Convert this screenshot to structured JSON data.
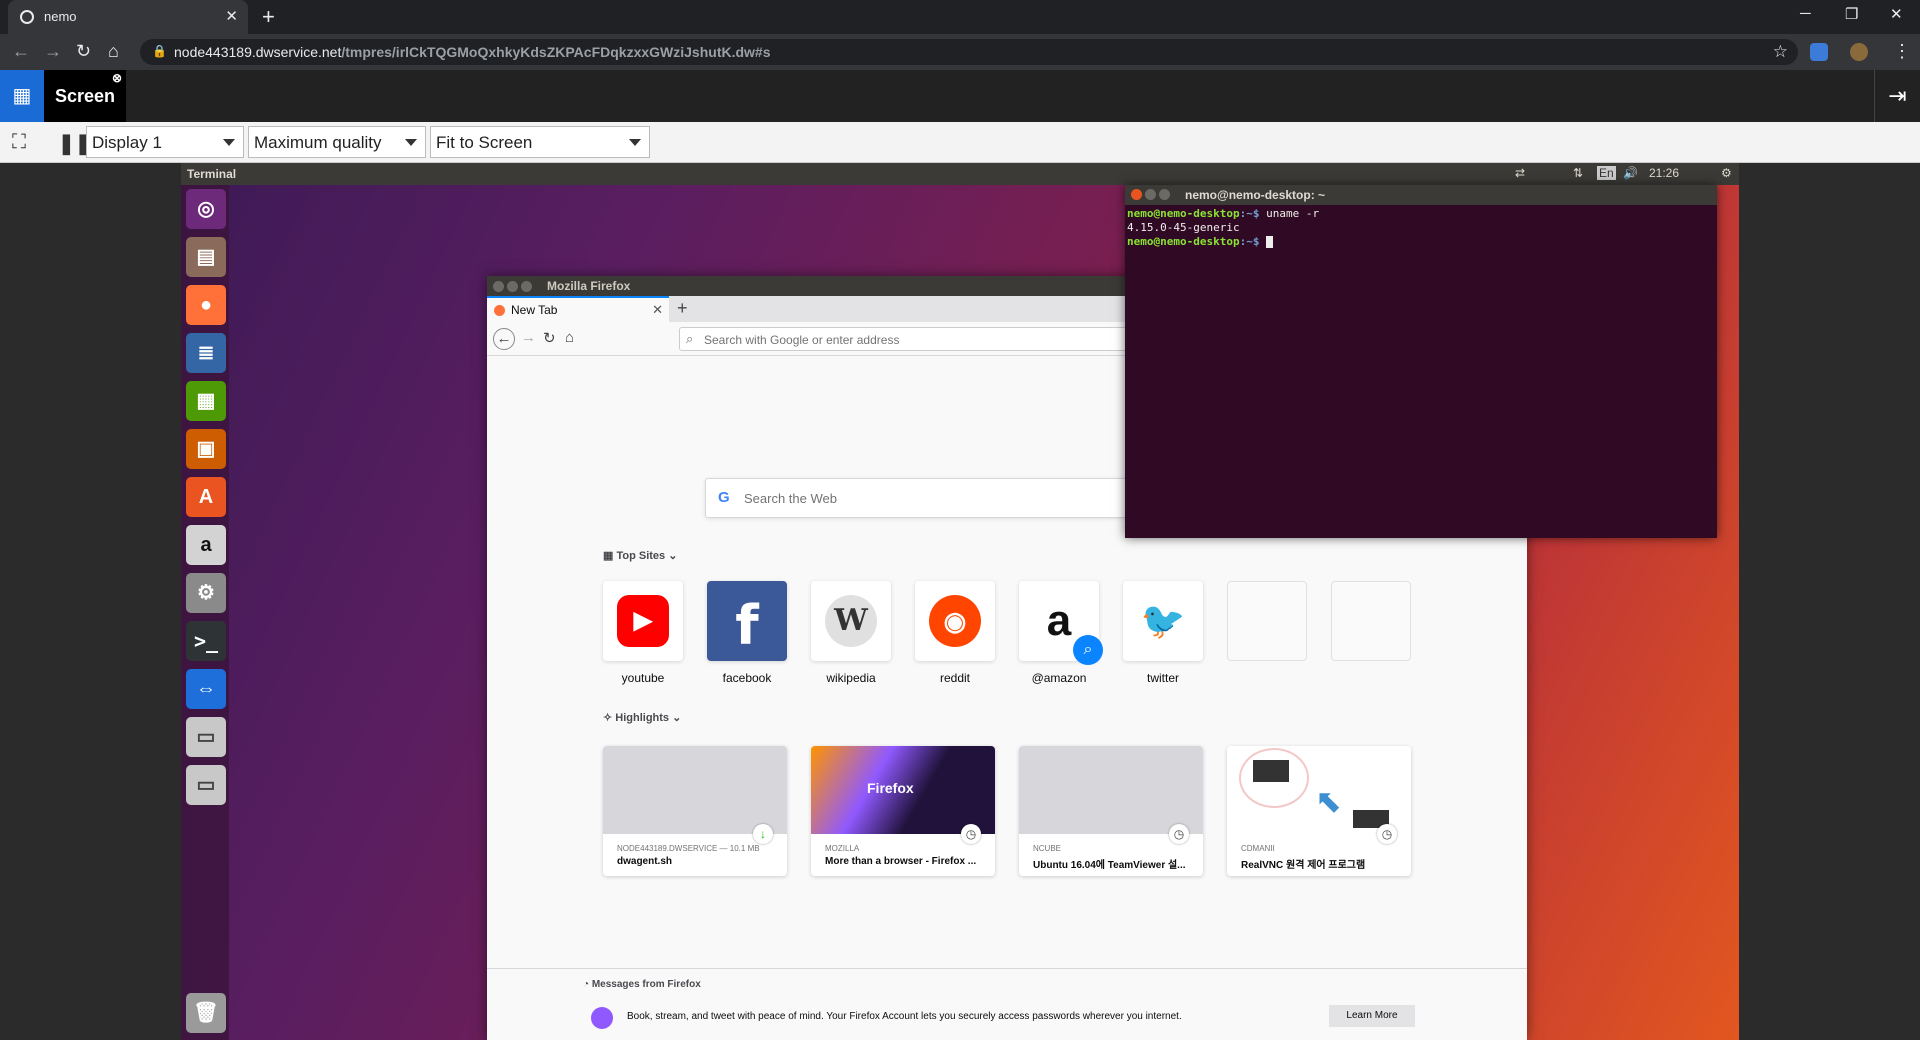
{
  "browser": {
    "tab_title": "nemo",
    "url_host": "node443189.dwservice.net",
    "url_path": "/tmpres/irlCkTQGMoQxhkyKdsZKPAcFDqkzxxGWziJshutK.dw#s"
  },
  "dwservice": {
    "screen_label": "Screen",
    "display_select": "Display 1",
    "quality_select": "Maximum quality",
    "fit_select": "Fit to Screen"
  },
  "remote": {
    "top_panel_title": "Terminal",
    "time": "21:26",
    "keyboard_lang": "En"
  },
  "firefox": {
    "window_title": "Mozilla Firefox",
    "tab_title": "New Tab",
    "address_placeholder": "Search with Google or enter address",
    "web_search_placeholder": "Search the Web",
    "top_sites_label": "Top Sites",
    "top_sites": [
      {
        "label": "youtube"
      },
      {
        "label": "facebook"
      },
      {
        "label": "wikipedia"
      },
      {
        "label": "reddit"
      },
      {
        "label": "@amazon"
      },
      {
        "label": "twitter"
      }
    ],
    "highlights_label": "Highlights",
    "highlights": [
      {
        "source": "NODE443189.DWSERVICE — 10.1 MB",
        "title": "dwagent.sh"
      },
      {
        "source": "MOZILLA",
        "title": "More than a browser - Firefox ..."
      },
      {
        "source": "NCUBE",
        "title": "Ubuntu 16.04에 TeamViewer 설..."
      },
      {
        "source": "CDMANII",
        "title": "RealVNC 원격 제어 프로그램"
      }
    ],
    "firefox_card_text": "Firefox",
    "messages_label": "Messages from Firefox",
    "messages_body": "Book, stream, and tweet with peace of mind. Your Firefox Account lets you securely access passwords wherever you internet.",
    "learn_more": "Learn More"
  },
  "terminal": {
    "title": "nemo@nemo-desktop: ~",
    "prompt_user": "nemo@nemo-desktop",
    "prompt_path": ":~$",
    "command": " uname -r",
    "output": "4.15.0-45-generic"
  }
}
